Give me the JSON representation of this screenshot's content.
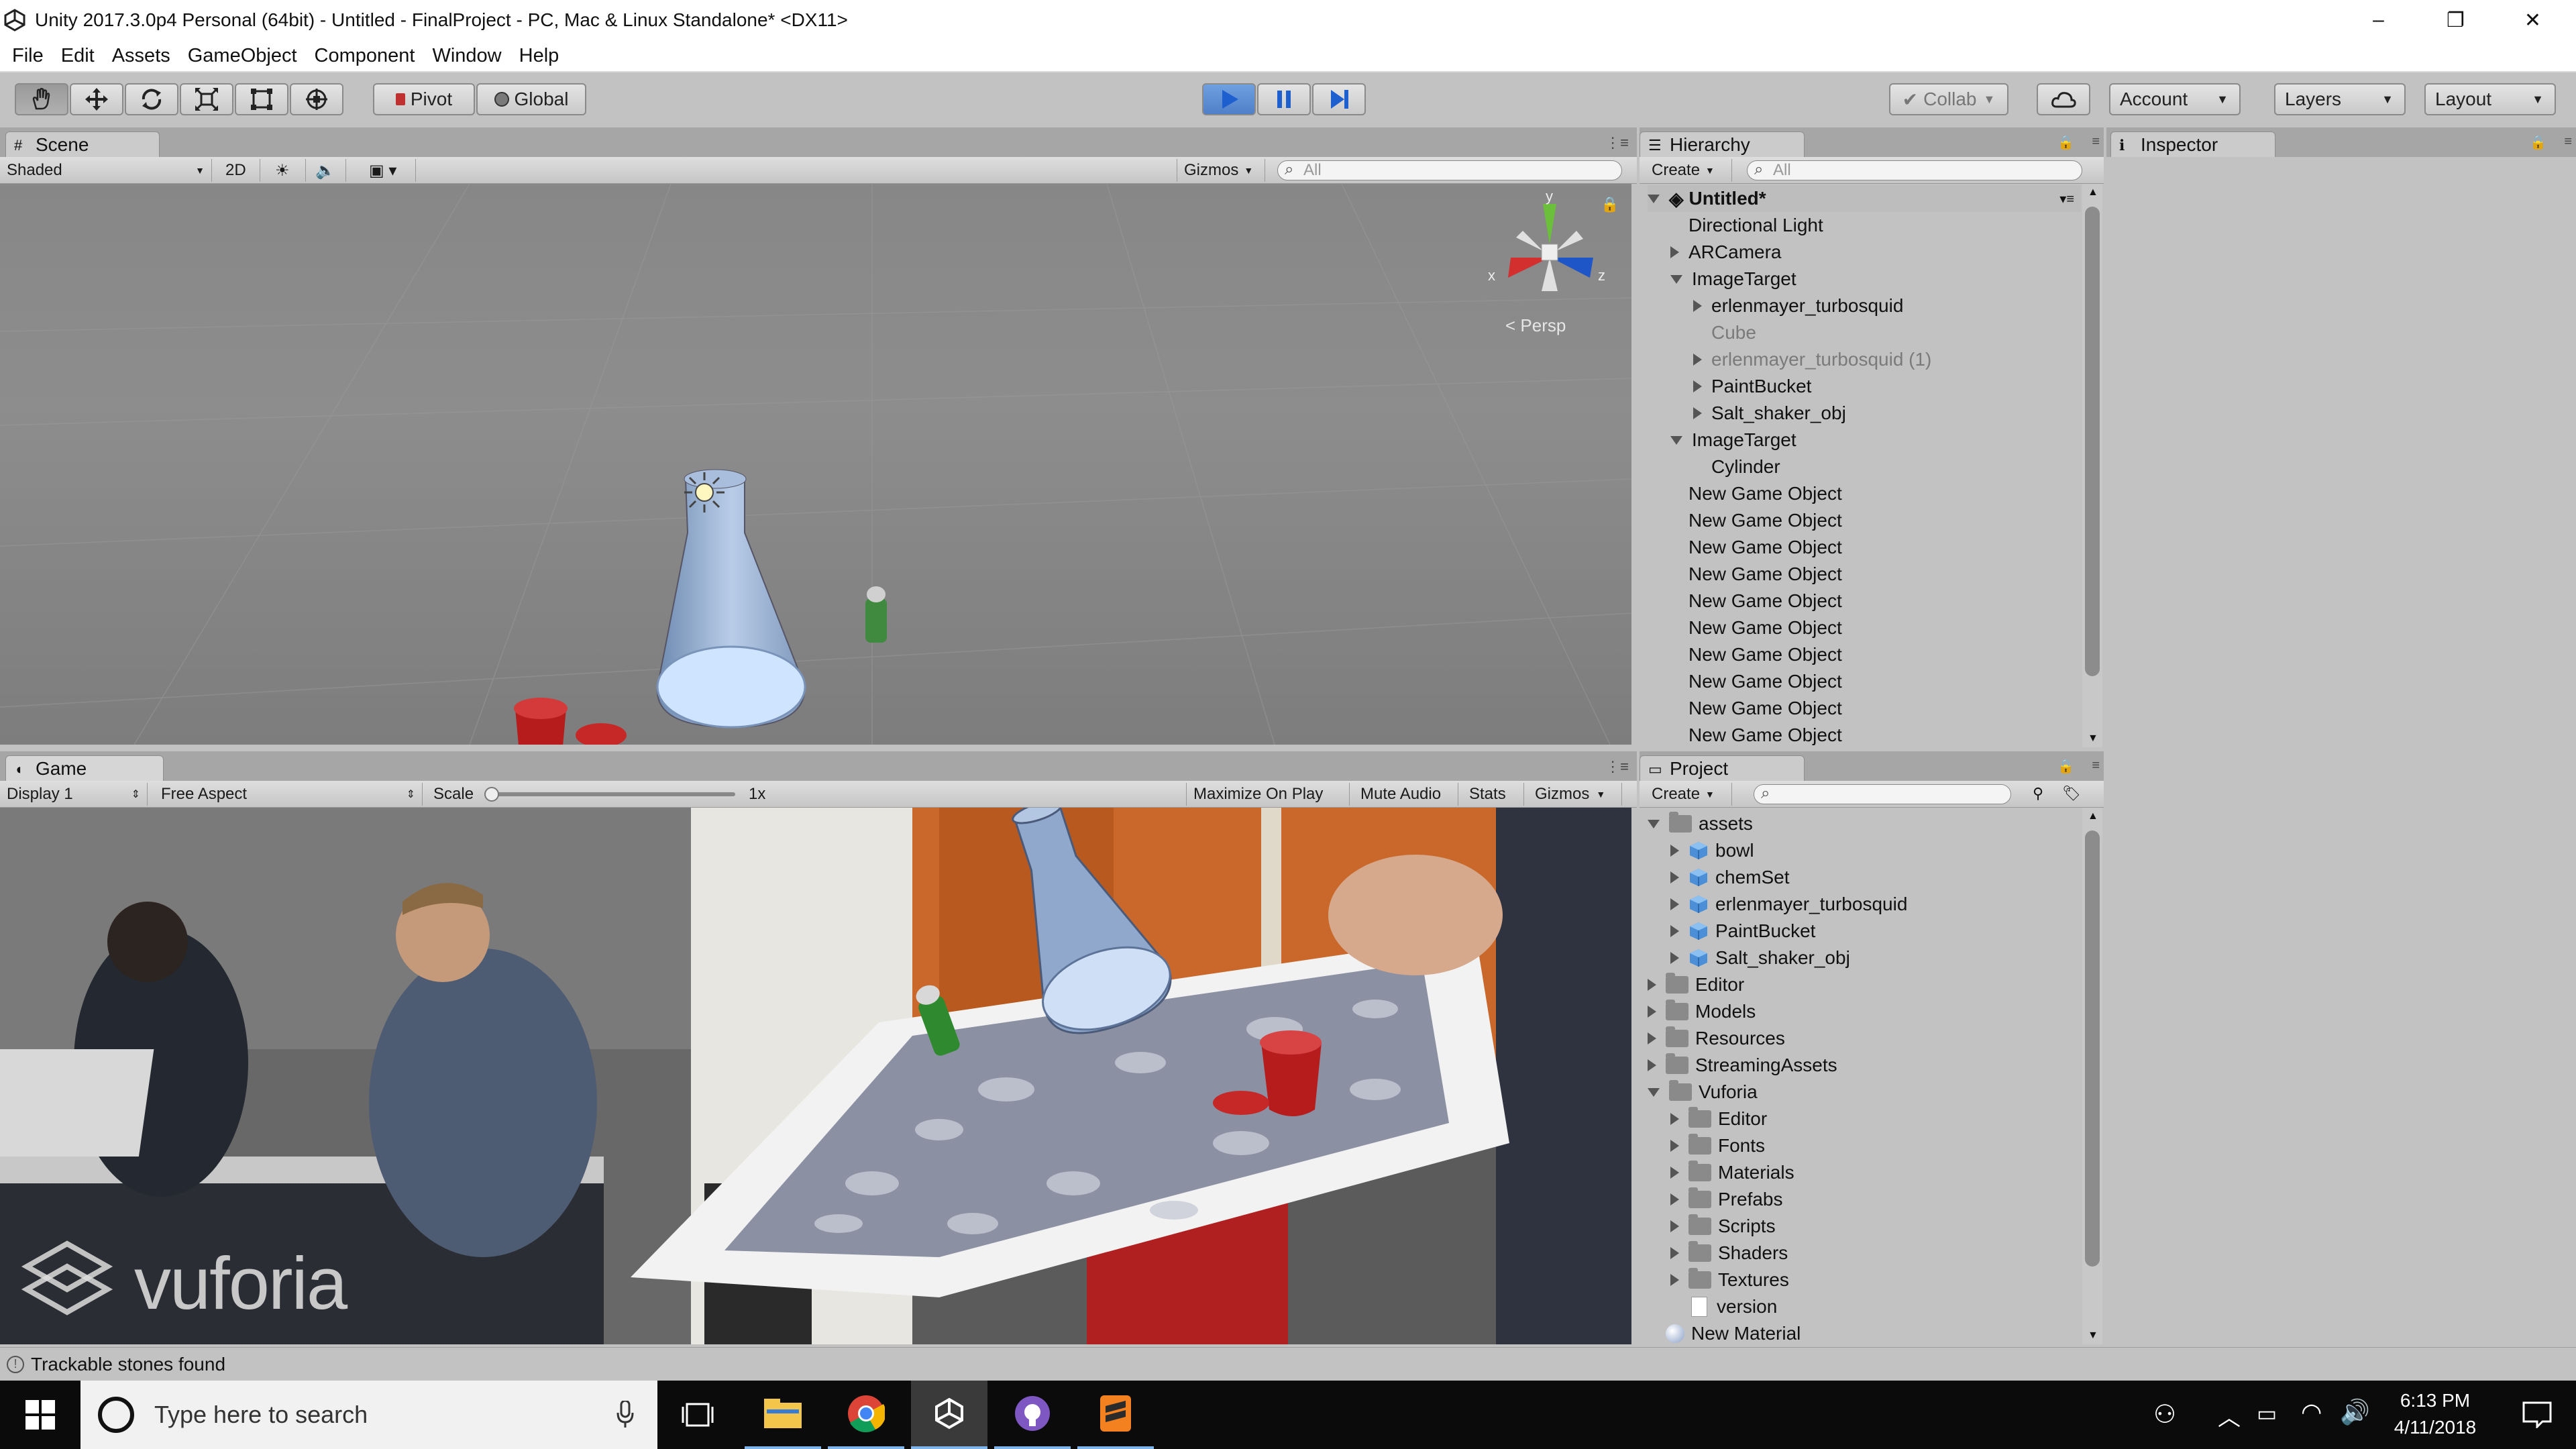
{
  "window": {
    "title": "Unity 2017.3.0p4 Personal (64bit) - Untitled - FinalProject - PC, Mac & Linux Standalone* <DX11>",
    "minimize": "–",
    "restore": "❐",
    "close": "✕"
  },
  "menu": [
    "File",
    "Edit",
    "Assets",
    "GameObject",
    "Component",
    "Window",
    "Help"
  ],
  "toolbar": {
    "pivot": "Pivot",
    "global": "Global",
    "collab": "Collab",
    "account": "Account",
    "layers": "Layers",
    "layout": "Layout"
  },
  "scene": {
    "tab": "Scene",
    "shading": "Shaded",
    "mode_2d": "2D",
    "gizmos": "Gizmos",
    "search_placeholder": "All",
    "persp": "Persp",
    "axis_x": "x",
    "axis_y": "y",
    "axis_z": "z"
  },
  "game": {
    "tab": "Game",
    "display": "Display 1",
    "aspect": "Free Aspect",
    "scale_label": "Scale",
    "scale_value": "1x",
    "maximize": "Maximize On Play",
    "mute": "Mute Audio",
    "stats": "Stats",
    "gizmos": "Gizmos",
    "watermark": "vuforia"
  },
  "hierarchy": {
    "tab": "Hierarchy",
    "create": "Create",
    "search_placeholder": "All",
    "root": "Untitled*",
    "items": [
      {
        "label": "Directional Light",
        "indent": 1,
        "arrow": "none",
        "dim": false
      },
      {
        "label": "ARCamera",
        "indent": 1,
        "arrow": "right",
        "dim": false
      },
      {
        "label": "ImageTarget",
        "indent": 1,
        "arrow": "down",
        "dim": false
      },
      {
        "label": "erlenmayer_turbosquid",
        "indent": 2,
        "arrow": "right",
        "dim": false
      },
      {
        "label": "Cube",
        "indent": 2,
        "arrow": "none",
        "dim": true
      },
      {
        "label": "erlenmayer_turbosquid (1)",
        "indent": 2,
        "arrow": "right",
        "dim": true
      },
      {
        "label": "PaintBucket",
        "indent": 2,
        "arrow": "right",
        "dim": false
      },
      {
        "label": "Salt_shaker_obj",
        "indent": 2,
        "arrow": "right",
        "dim": false
      },
      {
        "label": "ImageTarget",
        "indent": 1,
        "arrow": "down",
        "dim": false
      },
      {
        "label": "Cylinder",
        "indent": 2,
        "arrow": "none",
        "dim": false
      },
      {
        "label": "New Game Object",
        "indent": 1,
        "arrow": "none",
        "dim": false
      },
      {
        "label": "New Game Object",
        "indent": 1,
        "arrow": "none",
        "dim": false
      },
      {
        "label": "New Game Object",
        "indent": 1,
        "arrow": "none",
        "dim": false
      },
      {
        "label": "New Game Object",
        "indent": 1,
        "arrow": "none",
        "dim": false
      },
      {
        "label": "New Game Object",
        "indent": 1,
        "arrow": "none",
        "dim": false
      },
      {
        "label": "New Game Object",
        "indent": 1,
        "arrow": "none",
        "dim": false
      },
      {
        "label": "New Game Object",
        "indent": 1,
        "arrow": "none",
        "dim": false
      },
      {
        "label": "New Game Object",
        "indent": 1,
        "arrow": "none",
        "dim": false
      },
      {
        "label": "New Game Object",
        "indent": 1,
        "arrow": "none",
        "dim": false
      },
      {
        "label": "New Game Object",
        "indent": 1,
        "arrow": "none",
        "dim": false
      }
    ]
  },
  "inspector": {
    "tab": "Inspector"
  },
  "project": {
    "tab": "Project",
    "create": "Create",
    "items": [
      {
        "label": "assets",
        "indent": 0,
        "arrow": "down",
        "kind": "folder"
      },
      {
        "label": "bowl",
        "indent": 1,
        "arrow": "right",
        "kind": "prefab"
      },
      {
        "label": "chemSet",
        "indent": 1,
        "arrow": "right",
        "kind": "prefab"
      },
      {
        "label": "erlenmayer_turbosquid",
        "indent": 1,
        "arrow": "right",
        "kind": "prefab"
      },
      {
        "label": "PaintBucket",
        "indent": 1,
        "arrow": "right",
        "kind": "prefab"
      },
      {
        "label": "Salt_shaker_obj",
        "indent": 1,
        "arrow": "right",
        "kind": "prefab"
      },
      {
        "label": "Editor",
        "indent": 0,
        "arrow": "right",
        "kind": "folder"
      },
      {
        "label": "Models",
        "indent": 0,
        "arrow": "right",
        "kind": "folder"
      },
      {
        "label": "Resources",
        "indent": 0,
        "arrow": "right",
        "kind": "folder"
      },
      {
        "label": "StreamingAssets",
        "indent": 0,
        "arrow": "right",
        "kind": "folder"
      },
      {
        "label": "Vuforia",
        "indent": 0,
        "arrow": "down",
        "kind": "folder"
      },
      {
        "label": "Editor",
        "indent": 1,
        "arrow": "right",
        "kind": "folder"
      },
      {
        "label": "Fonts",
        "indent": 1,
        "arrow": "right",
        "kind": "folder"
      },
      {
        "label": "Materials",
        "indent": 1,
        "arrow": "right",
        "kind": "folder"
      },
      {
        "label": "Prefabs",
        "indent": 1,
        "arrow": "right",
        "kind": "folder"
      },
      {
        "label": "Scripts",
        "indent": 1,
        "arrow": "right",
        "kind": "folder"
      },
      {
        "label": "Shaders",
        "indent": 1,
        "arrow": "right",
        "kind": "folder"
      },
      {
        "label": "Textures",
        "indent": 1,
        "arrow": "right",
        "kind": "folder"
      },
      {
        "label": "version",
        "indent": 1,
        "arrow": "none",
        "kind": "file"
      },
      {
        "label": "New Material",
        "indent": 0,
        "arrow": "none",
        "kind": "material"
      }
    ]
  },
  "status": {
    "message": "Trackable stones found"
  },
  "taskbar": {
    "search_placeholder": "Type here to search",
    "time": "6:13 PM",
    "date": "4/11/2018"
  }
}
